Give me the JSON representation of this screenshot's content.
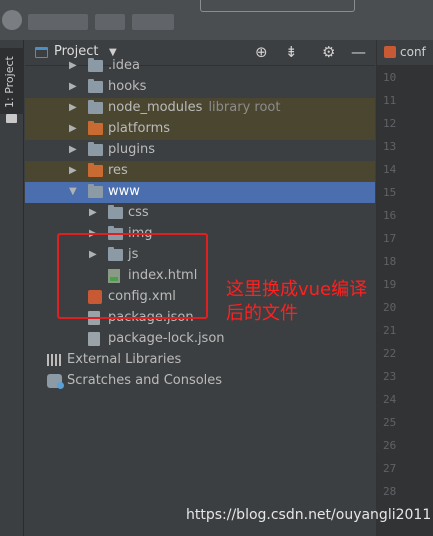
{
  "tool_window": {
    "tab_label": "1: Project"
  },
  "header": {
    "title": "Project",
    "icons": [
      "target-icon",
      "collapse-icon",
      "gear-icon",
      "minimize-icon"
    ]
  },
  "editor": {
    "tab_label": "conf",
    "line_numbers": [
      "10",
      "11",
      "12",
      "13",
      "14",
      "15",
      "16",
      "17",
      "18",
      "19",
      "20",
      "21",
      "22",
      "23",
      "24",
      "25",
      "26",
      "27",
      "28"
    ]
  },
  "tree": [
    {
      "label": ".idea",
      "suffix": "",
      "icon": "folder-icon",
      "depth": 1,
      "expanded": false,
      "style": "normal"
    },
    {
      "label": "hooks",
      "suffix": "",
      "icon": "folder-icon",
      "depth": 1,
      "expanded": false,
      "style": "normal"
    },
    {
      "label": "node_modules",
      "suffix": "library root",
      "icon": "folder-icon",
      "depth": 1,
      "expanded": false,
      "style": "tinted"
    },
    {
      "label": "platforms",
      "suffix": "",
      "icon": "folder-orange-icon",
      "depth": 1,
      "expanded": false,
      "style": "tinted"
    },
    {
      "label": "plugins",
      "suffix": "",
      "icon": "folder-icon",
      "depth": 1,
      "expanded": false,
      "style": "normal"
    },
    {
      "label": "res",
      "suffix": "",
      "icon": "folder-orange-icon",
      "depth": 1,
      "expanded": false,
      "style": "tinted"
    },
    {
      "label": "www",
      "suffix": "",
      "icon": "folder-icon",
      "depth": 1,
      "expanded": true,
      "style": "selected"
    },
    {
      "label": "css",
      "suffix": "",
      "icon": "folder-icon",
      "depth": 2,
      "expanded": false,
      "style": "normal"
    },
    {
      "label": "img",
      "suffix": "",
      "icon": "folder-icon",
      "depth": 2,
      "expanded": false,
      "style": "normal"
    },
    {
      "label": "js",
      "suffix": "",
      "icon": "folder-icon",
      "depth": 2,
      "expanded": false,
      "style": "normal"
    },
    {
      "label": "index.html",
      "suffix": "",
      "icon": "html-file-icon",
      "depth": 2,
      "expanded": null,
      "style": "normal"
    },
    {
      "label": "config.xml",
      "suffix": "",
      "icon": "xml-file-icon",
      "depth": 1,
      "expanded": null,
      "style": "normal"
    },
    {
      "label": "package.json",
      "suffix": "",
      "icon": "json-file-icon",
      "depth": 1,
      "expanded": null,
      "style": "normal"
    },
    {
      "label": "package-lock.json",
      "suffix": "",
      "icon": "json-file-icon",
      "depth": 1,
      "expanded": null,
      "style": "normal"
    },
    {
      "label": "External Libraries",
      "suffix": "",
      "icon": "libraries-icon",
      "depth": 0,
      "expanded": null,
      "style": "normal"
    },
    {
      "label": "Scratches and Consoles",
      "suffix": "",
      "icon": "scratches-icon",
      "depth": 0,
      "expanded": null,
      "style": "normal"
    }
  ],
  "annotation": {
    "text": "这里换成vue编译后的文件",
    "color": "#ff2020"
  },
  "watermark": "https://blog.csdn.net/ouyangli2011",
  "colors": {
    "selection": "#4b6eaf",
    "excluded_tint": "#4b4630",
    "panel": "#3c3f41",
    "editor_bg": "#2b2b2b"
  }
}
